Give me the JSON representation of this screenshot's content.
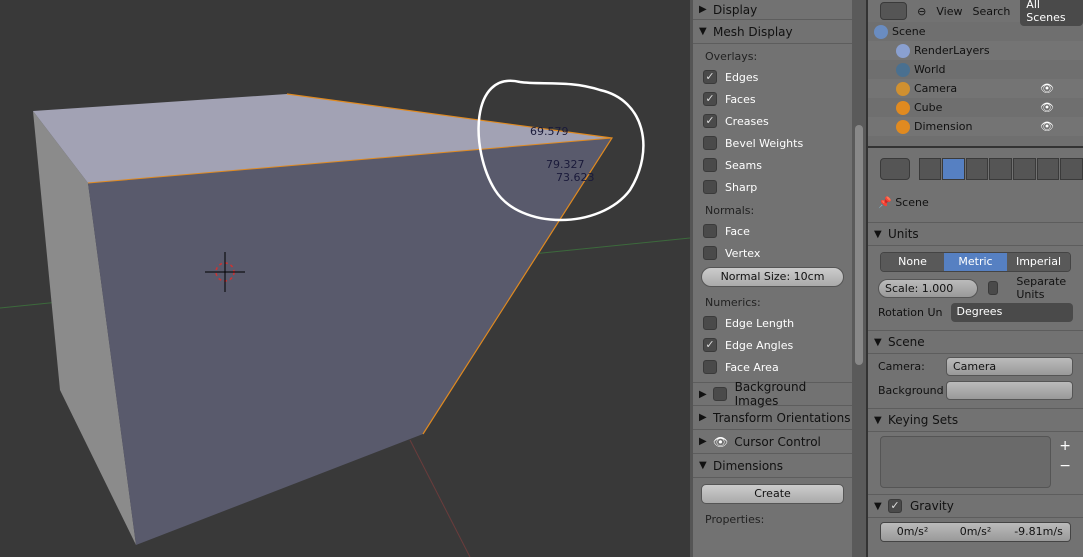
{
  "viewport": {
    "edge_angles": [
      "69.579",
      "79.327",
      "73.623"
    ]
  },
  "tools": {
    "display": "Display",
    "mesh_display": "Mesh Display",
    "overlays": "Overlays:",
    "overlay_items": [
      {
        "label": "Edges",
        "checked": true
      },
      {
        "label": "Faces",
        "checked": true
      },
      {
        "label": "Creases",
        "checked": true
      },
      {
        "label": "Bevel Weights",
        "checked": false
      },
      {
        "label": "Seams",
        "checked": false
      },
      {
        "label": "Sharp",
        "checked": false
      }
    ],
    "normals": "Normals:",
    "normal_items": [
      {
        "label": "Face",
        "checked": false
      },
      {
        "label": "Vertex",
        "checked": false
      }
    ],
    "normal_size": "Normal Size: 10cm",
    "numerics": "Numerics:",
    "numeric_items": [
      {
        "label": "Edge Length",
        "checked": false
      },
      {
        "label": "Edge Angles",
        "checked": true
      },
      {
        "label": "Face Area",
        "checked": false
      }
    ],
    "background_images": "Background Images",
    "transform_orientations": "Transform Orientations",
    "cursor_control": "Cursor Control",
    "dimensions": "Dimensions",
    "create": "Create",
    "properties": "Properties:"
  },
  "outliner": {
    "view": "View",
    "search": "Search",
    "scenes": "All Scenes",
    "items": [
      "Scene",
      "RenderLayers",
      "World",
      "Camera",
      "Cube",
      "Dimension"
    ]
  },
  "properties": {
    "context": "Scene",
    "units": "Units",
    "unit_options": [
      "None",
      "Metric",
      "Imperial"
    ],
    "unit_selected": "Metric",
    "scale": "Scale: 1.000",
    "separate_units": "Separate Units",
    "rotation_label": "Rotation Un",
    "rotation_value": "Degrees",
    "scene": "Scene",
    "camera_label": "Camera:",
    "camera_value": "Camera",
    "background_label": "Background",
    "keying_sets": "Keying Sets",
    "gravity": "Gravity",
    "gravity_values": [
      "0m/s²",
      "0m/s²",
      "-9.81m/s"
    ]
  }
}
